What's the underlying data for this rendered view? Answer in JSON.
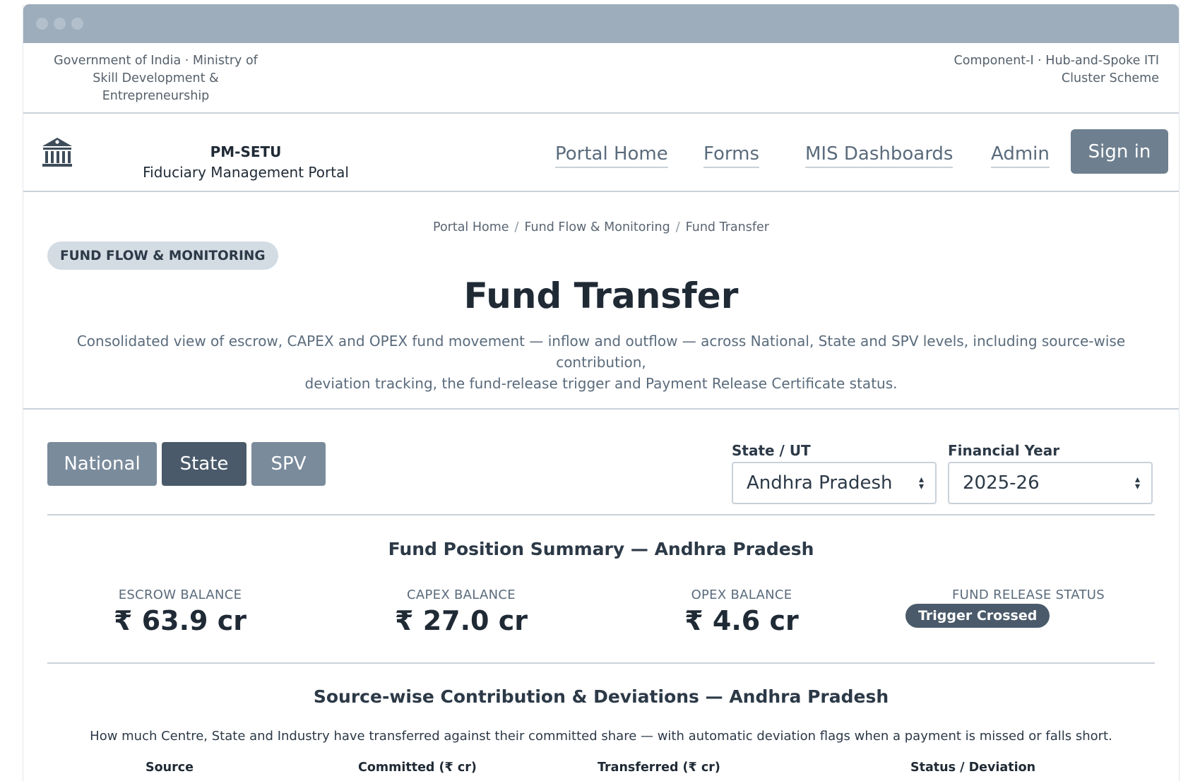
{
  "gov_strip": {
    "left_lines": [
      "Government of India · Ministry of",
      "Skill Development &",
      "Entrepreneurship"
    ],
    "right_lines": [
      "Component-I · Hub-and-Spoke ITI",
      "Cluster Scheme"
    ]
  },
  "brand": {
    "title": "PM-SETU",
    "subtitle": "Fiduciary Management Portal",
    "logo_icon": "government-building-icon"
  },
  "nav": {
    "links": [
      "Portal Home",
      "Forms",
      "MIS Dashboards",
      "Admin"
    ],
    "signin_label": "Sign in"
  },
  "breadcrumb": [
    "Portal Home",
    "Fund Flow & Monitoring",
    "Fund Transfer"
  ],
  "section_pill": "FUND FLOW & MONITORING",
  "page": {
    "title": "Fund Transfer",
    "description_lines": [
      "Consolidated view of escrow, CAPEX and OPEX fund movement — inflow and outflow — across National, State and SPV levels, including source-wise contribution,",
      "deviation tracking, the fund-release trigger and Payment Release Certificate status."
    ]
  },
  "level_tabs": {
    "items": [
      "National",
      "State",
      "SPV"
    ],
    "active": "State"
  },
  "filters": {
    "state_label": "State / UT",
    "state_value": "Andhra Pradesh",
    "fy_label": "Financial Year",
    "fy_value": "2025-26"
  },
  "summary": {
    "title": "Fund Position Summary — Andhra Pradesh",
    "metrics": [
      {
        "label": "ESCROW BALANCE",
        "value": "₹ 63.9 cr"
      },
      {
        "label": "CAPEX BALANCE",
        "value": "₹ 27.0 cr"
      },
      {
        "label": "OPEX BALANCE",
        "value": "₹ 4.6 cr"
      }
    ],
    "status_label": "FUND RELEASE STATUS",
    "status_value": "Trigger Crossed"
  },
  "contribution": {
    "title": "Source-wise Contribution & Deviations — Andhra Pradesh",
    "description": "How much Centre, State and Industry have transferred against their committed share — with automatic deviation flags when a payment is missed or falls short.",
    "columns": [
      "Source",
      "Committed (₹ cr)",
      "Transferred (₹ cr)",
      "Status / Deviation"
    ]
  },
  "colors": {
    "titlebar": "#9eadbb",
    "primary_button": "#6e7f8f",
    "active_tab": "#4a5a6a",
    "inactive_tab": "#7a8b9c"
  }
}
